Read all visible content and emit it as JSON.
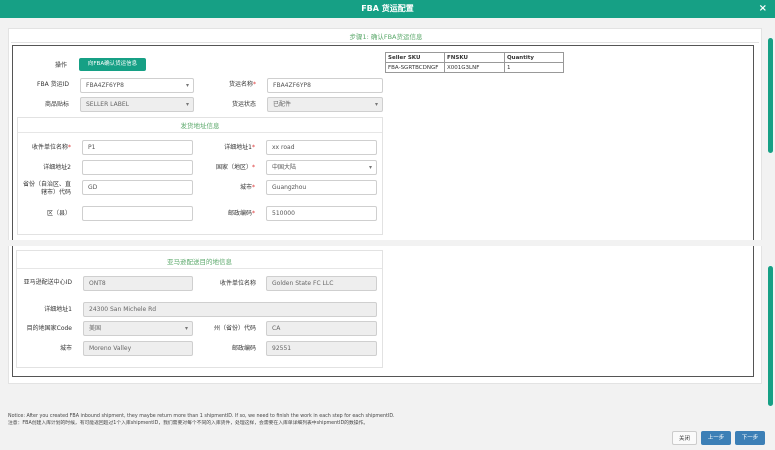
{
  "window": {
    "title": "FBA 货运配置",
    "close": "×"
  },
  "step_title": "步骤1: 确认FBA货运信息",
  "top": {
    "operation_label": "操作",
    "operation_button": "向FBA确认货运信息",
    "shipment_id_label": "FBA 货运ID",
    "shipment_id_value": "FBA4ZF6YP8",
    "shipment_name_label": "货运名称",
    "shipment_name_value": "FBA4ZF6YP8",
    "label_type_label": "商品贴标",
    "label_type_value": "SELLER LABEL",
    "status_label": "货运状态",
    "status_value": "已配件"
  },
  "sku_table": {
    "headers": [
      "Seller SKU",
      "FNSKU",
      "Quantity"
    ],
    "rows": [
      [
        "FBA-SGRTBCDNGF",
        "X001G3LNF",
        "1"
      ]
    ]
  },
  "ship_from": {
    "title": "发货地址信息",
    "contact_label": "收件单位名称",
    "contact_value": "P1",
    "addr1_label": "详细地址1",
    "addr1_value": "xx road",
    "addr2_label": "详细地址2",
    "addr2_value": "",
    "country_label": "国家（地区）",
    "country_value": "中国大陆",
    "province_label": "省份（自治区、直辖市）代码",
    "province_value": "GD",
    "city_label": "城市",
    "city_value": "Guangzhou",
    "district_label": "区（县）",
    "district_value": "",
    "postal_label": "邮政编码",
    "postal_value": "510000"
  },
  "ship_to": {
    "title": "亚马逊配送目的地信息",
    "center_label": "亚马逊配送中心ID",
    "center_value": "ONT8",
    "recipient_label": "收件单位名称",
    "recipient_value": "Golden State FC LLC",
    "addr_label": "详细地址1",
    "addr_value": "24300 San Michele Rd",
    "country_label": "目的地国家Code",
    "country_value": "美国",
    "state_label": "州（省份）代码",
    "state_value": "CA",
    "city_label": "城市",
    "city_value": "Moreno Valley",
    "postal_label": "邮政编码",
    "postal_value": "92551"
  },
  "notice": {
    "line1": "Notice: After you created FBA inbound shipment, they maybe return more than 1 shipmentID. If so, we need to finish the work in each step for each shipmentID.",
    "line2": "注意：FBA创建入库计划的时候，有可能返回超过1个入库shipmentID，我们需要对每个不同的入库货件，处理这样，会需要在入库单详细列表中shipmentID的数操作。"
  },
  "footer": {
    "close": "关闭",
    "prev": "上一步",
    "next": "下一步"
  },
  "colors": {
    "accent": "#16a085",
    "primary": "#3c7fb6"
  }
}
